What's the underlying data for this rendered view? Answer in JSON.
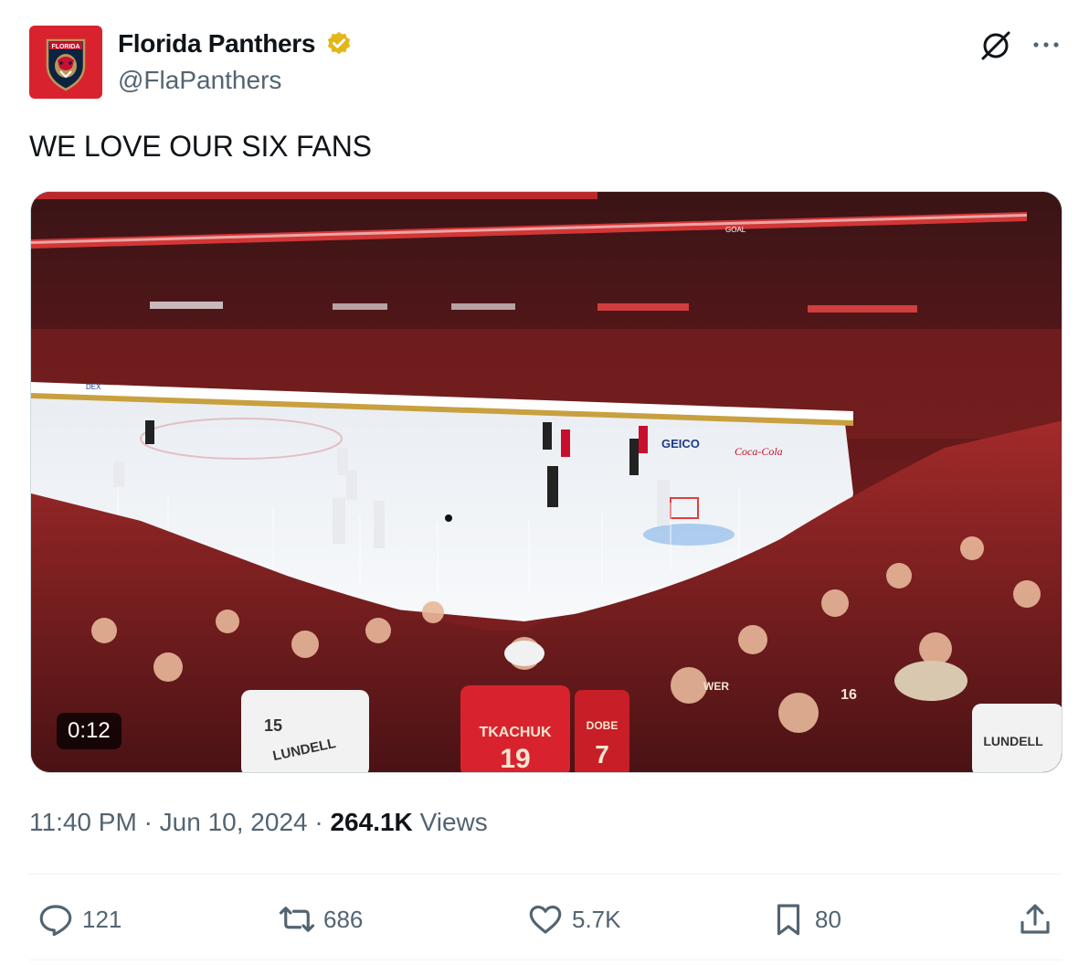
{
  "author": {
    "display_name": "Florida Panthers",
    "handle": "@FlaPanthers",
    "avatar_icon": "florida-panthers-logo",
    "avatar_text": "FLORIDA",
    "verified_color": "#e2b719"
  },
  "tweet": {
    "text": "WE LOVE OUR SIX FANS",
    "time": "11:40 PM",
    "date": "Jun 10, 2024",
    "views_count": "264.1K",
    "views_label": "Views",
    "separator": "·"
  },
  "media": {
    "duration": "0:12",
    "board_texts": [
      "GEICO",
      "GOAL",
      "Coca-Cola",
      "DEX"
    ],
    "jersey_texts": [
      "TKACHUK",
      "LUNDELL",
      "LUNDELL",
      "19",
      "7",
      "15",
      "16",
      "DOBE",
      "WER"
    ]
  },
  "actions": {
    "replies": "121",
    "reposts": "686",
    "likes": "5.7K",
    "bookmarks": "80"
  },
  "colors": {
    "accent_red": "#d8232f",
    "muted_text": "#536471",
    "primary_text": "#0f1419"
  }
}
